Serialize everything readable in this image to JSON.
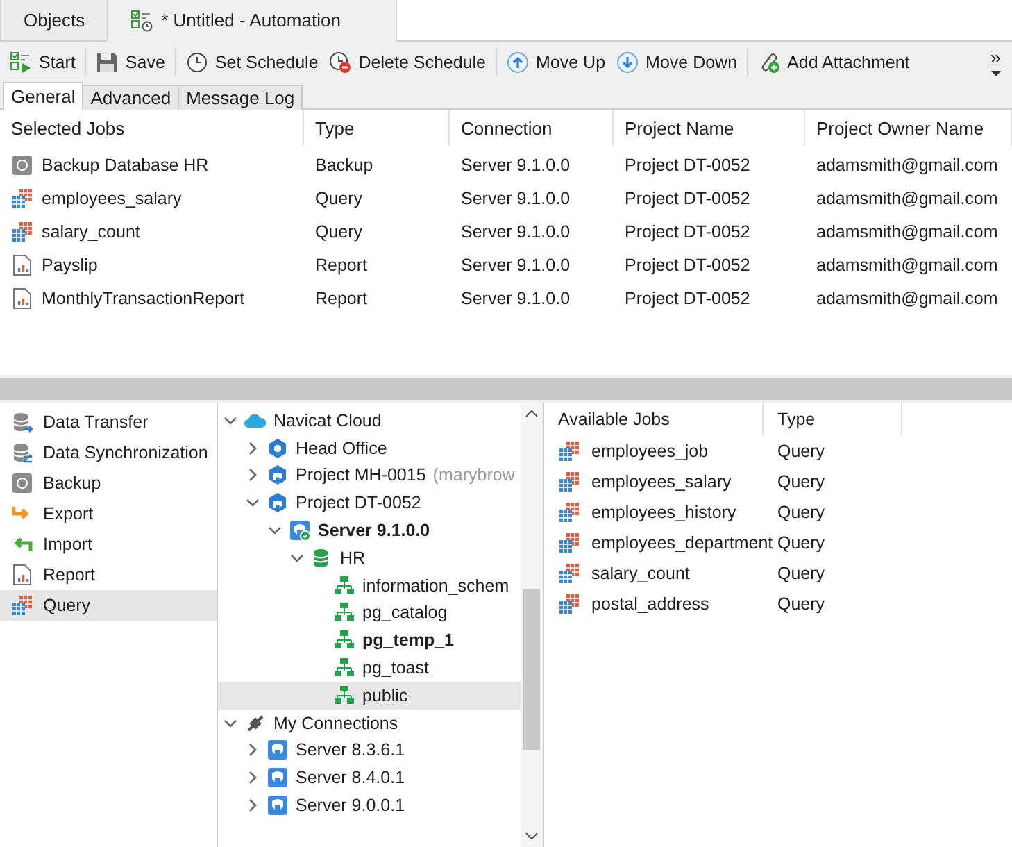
{
  "doc_tabs": [
    {
      "label": "Objects",
      "kind": "plain",
      "selected": false
    },
    {
      "label": "* Untitled - Automation",
      "kind": "automation",
      "selected": true
    }
  ],
  "toolbar": {
    "buttons": [
      {
        "label": "Start",
        "kind": "start"
      },
      {
        "label": "Save",
        "kind": "save"
      },
      {
        "label": "Set Schedule",
        "kind": "schedule"
      },
      {
        "label": "Delete Schedule",
        "kind": "delschedule"
      },
      {
        "label": "Move Up",
        "kind": "up"
      },
      {
        "label": "Move Down",
        "kind": "down"
      },
      {
        "label": "Add Attachment",
        "kind": "attach"
      }
    ],
    "overflow": "»"
  },
  "sub_tabs": [
    {
      "label": "General",
      "selected": true
    },
    {
      "label": "Advanced",
      "selected": false
    },
    {
      "label": "Message Log",
      "selected": false
    }
  ],
  "selected_jobs": {
    "columns": [
      "Selected Jobs",
      "Type",
      "Connection",
      "Project Name",
      "Project Owner Name"
    ],
    "rows": [
      {
        "kind": "backup",
        "cells": [
          "Backup Database HR",
          "Backup",
          "Server 9.1.0.0",
          "Project DT-0052",
          "adamsmith@gmail.com"
        ]
      },
      {
        "kind": "query",
        "cells": [
          "employees_salary",
          "Query",
          "Server 9.1.0.0",
          "Project DT-0052",
          "adamsmith@gmail.com"
        ]
      },
      {
        "kind": "query",
        "cells": [
          "salary_count",
          "Query",
          "Server 9.1.0.0",
          "Project DT-0052",
          "adamsmith@gmail.com"
        ]
      },
      {
        "kind": "report",
        "cells": [
          "Payslip",
          "Report",
          "Server 9.1.0.0",
          "Project DT-0052",
          "adamsmith@gmail.com"
        ]
      },
      {
        "kind": "report",
        "cells": [
          "MonthlyTransactionReport",
          "Report",
          "Server 9.1.0.0",
          "Project DT-0052",
          "adamsmith@gmail.com"
        ]
      }
    ]
  },
  "categories": [
    {
      "label": "Data Transfer",
      "kind": "transfer",
      "selected": false
    },
    {
      "label": "Data Synchronization",
      "kind": "sync",
      "selected": false
    },
    {
      "label": "Backup",
      "kind": "backup",
      "selected": false
    },
    {
      "label": "Export",
      "kind": "export",
      "selected": false
    },
    {
      "label": "Import",
      "kind": "import",
      "selected": false
    },
    {
      "label": "Report",
      "kind": "report",
      "selected": false
    },
    {
      "label": "Query",
      "kind": "query",
      "selected": true
    }
  ],
  "tree": [
    {
      "label": "Navicat Cloud",
      "kind": "cloud",
      "expanded": true,
      "selected": false,
      "children": [
        {
          "label": "Head Office",
          "kind": "hexagon",
          "expanded": false,
          "selected": false
        },
        {
          "label": "Project MH-0015",
          "owner": "(marybrow",
          "kind": "project",
          "expanded": false,
          "selected": false
        },
        {
          "label": "Project DT-0052",
          "kind": "project",
          "expanded": true,
          "selected": false,
          "children": [
            {
              "label": "Server 9.1.0.0",
              "kind": "server_on",
              "open": true,
              "expanded": true,
              "selected": false,
              "children": [
                {
                  "label": "HR",
                  "kind": "database",
                  "expanded": true,
                  "selected": false,
                  "children": [
                    {
                      "label": "information_schem",
                      "kind": "schema",
                      "selected": false
                    },
                    {
                      "label": "pg_catalog",
                      "kind": "schema",
                      "selected": false
                    },
                    {
                      "label": "pg_temp_1",
                      "kind": "schema",
                      "open": true,
                      "selected": false
                    },
                    {
                      "label": "pg_toast",
                      "kind": "schema",
                      "selected": false
                    },
                    {
                      "label": "public",
                      "kind": "schema",
                      "selected": true
                    }
                  ]
                }
              ]
            }
          ]
        }
      ]
    },
    {
      "label": "My Connections",
      "kind": "connections",
      "expanded": true,
      "selected": false,
      "children": [
        {
          "label": "Server 8.3.6.1",
          "kind": "server",
          "expanded": false,
          "selected": false
        },
        {
          "label": "Server 8.4.0.1",
          "kind": "server",
          "expanded": false,
          "selected": false
        },
        {
          "label": "Server 9.0.0.1",
          "kind": "server",
          "expanded": false,
          "selected": false
        }
      ]
    }
  ],
  "available_jobs": {
    "columns": [
      "Available Jobs",
      "Type"
    ],
    "rows": [
      {
        "kind": "query",
        "cells": [
          "employees_job",
          "Query"
        ]
      },
      {
        "kind": "query",
        "cells": [
          "employees_salary",
          "Query"
        ]
      },
      {
        "kind": "query",
        "cells": [
          "employees_history",
          "Query"
        ]
      },
      {
        "kind": "query",
        "cells": [
          "employees_department",
          "Query"
        ]
      },
      {
        "kind": "query",
        "cells": [
          "salary_count",
          "Query"
        ]
      },
      {
        "kind": "query",
        "cells": [
          "postal_address",
          "Query"
        ]
      }
    ]
  }
}
